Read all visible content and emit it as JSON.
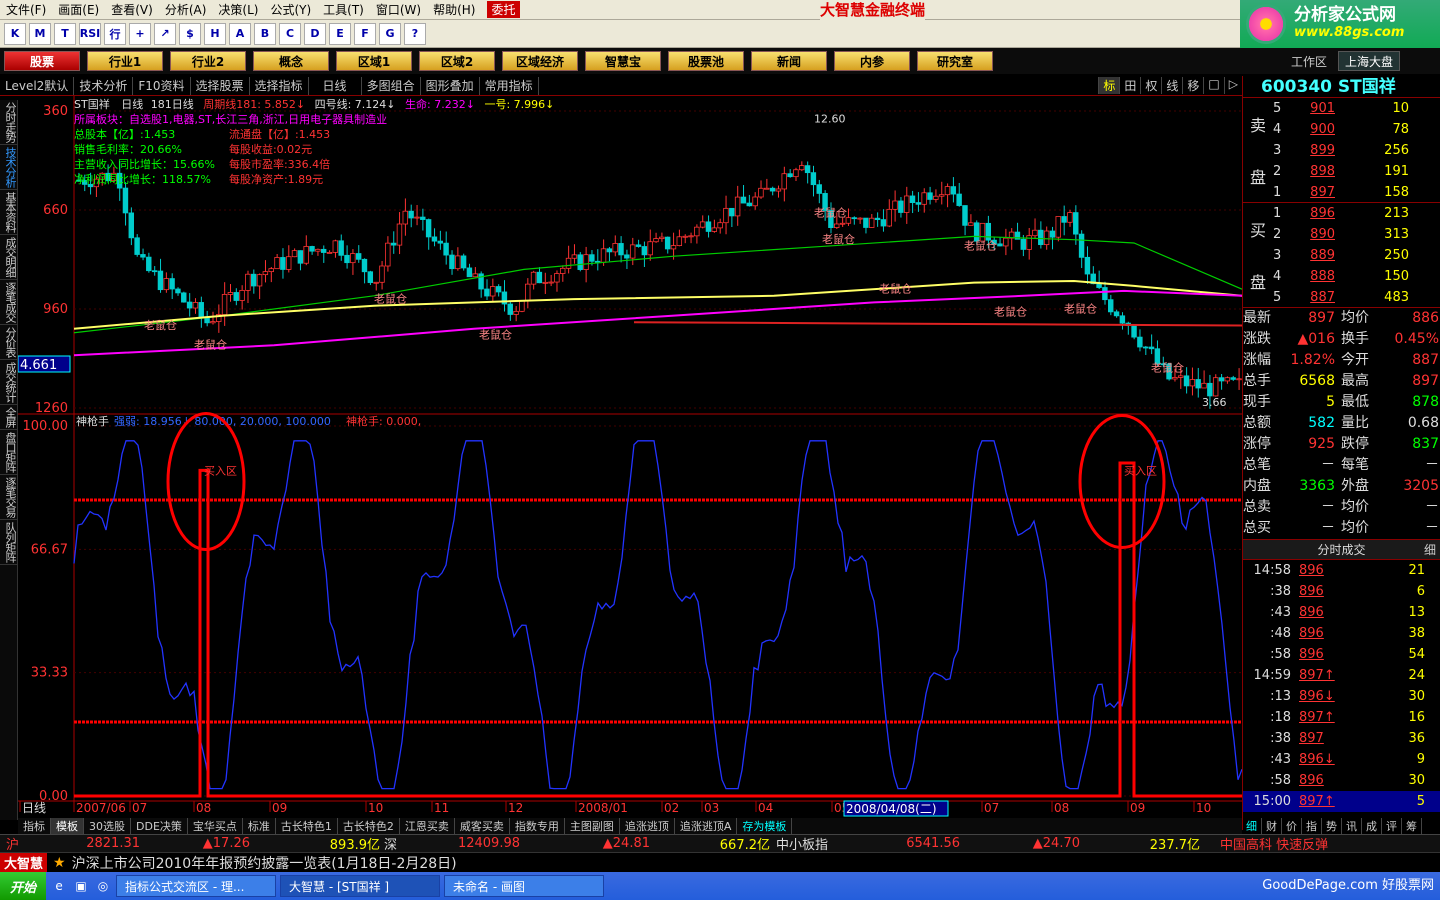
{
  "menu": [
    "文件(F)",
    "画面(E)",
    "查看(V)",
    "分析(A)",
    "决策(L)",
    "公式(Y)",
    "工具(T)",
    "窗口(W)",
    "帮助(H)"
  ],
  "menu_extra": "委托",
  "app_title": "大智慧金融终端",
  "logo": {
    "name": "分析家公式网",
    "url": "www.88gs.com"
  },
  "toolbar_icons": [
    "K",
    "M",
    "T",
    "RSI",
    "行",
    "+",
    "↗",
    "$",
    "H",
    "A",
    "B",
    "C",
    "D",
    "E",
    "F",
    "G",
    "?"
  ],
  "nav": [
    "股票",
    "行业1",
    "行业2",
    "概念",
    "区域1",
    "区域2",
    "区域经济",
    "智慧宝",
    "股票池",
    "新闻",
    "内参",
    "研究室"
  ],
  "nav_right": {
    "workspace": "工作区",
    "market": "上海大盘"
  },
  "subbar": [
    "Level2默认",
    "技术分析",
    "F10资料",
    "选择股票",
    "选择指标",
    "日线",
    "多图组合",
    "图形叠加",
    "常用指标"
  ],
  "subbar_right": [
    "标",
    "田",
    "权",
    "线",
    "移",
    "□",
    "▷"
  ],
  "left_tabs": [
    "分时走势",
    "技术分析",
    "基本资料",
    "成交明细",
    "逐笔成交",
    "分价表",
    "成交统计",
    "全屏",
    "盘口矩阵",
    "逐笔交易",
    "队列矩阵"
  ],
  "chart_header": {
    "name": "ST国祥",
    "period": "日线",
    "ma": "181日线",
    "zhouqi": "周期线181: 5.852↓",
    "sihao": "四号线: 7.124↓",
    "shengming": "生命: 7.232↓",
    "yihao": "一号: 7.996↓",
    "sector": "所属板块：自选股1,电器,ST,长江三角,浙江,日用电子器具制造业",
    "info_left": [
      "总股本【亿】:1.453",
      "销售毛利率：20.66%",
      "主营收入同比增长：15.66%",
      "净利润同比增长：118.57%"
    ],
    "info_right": [
      "流通盘【亿】:1.453",
      "每股收益:0.02元",
      "每股市盈率:336.4倍",
      "每股净资产:1.89元"
    ],
    "price_axis": [
      "1260",
      "960",
      "660",
      "360"
    ],
    "current_price_tag": "4.661",
    "max_label": "12.60",
    "min_label": "3.66",
    "mouse_labels": "老鼠仓"
  },
  "indicator": {
    "name": "神枪手",
    "line1": "强弱: 18.956↓  80.000, 20.000, 100.000",
    "line2": "神枪手: 0.000,",
    "axis": [
      "100.00",
      "66.67",
      "33.33",
      "0.00"
    ],
    "buy_zone": "买入区"
  },
  "chart_data": {
    "type": "line",
    "price_axis": [
      360,
      660,
      960,
      1260
    ],
    "indicator_axis": [
      0,
      33.33,
      66.67,
      100
    ],
    "levels": [
      80,
      20
    ]
  },
  "date_axis": [
    "日线",
    "2007/06",
    "07",
    "08",
    "09",
    "10",
    "11",
    "12",
    "2008/01",
    "02",
    "03",
    "04",
    "05",
    "06",
    "07",
    "08",
    "09",
    "10"
  ],
  "date_highlight": "2008/04/08(二)",
  "bottom_tabs": [
    "指标",
    "模板",
    "30选股",
    "DDE决策",
    "宝华买点",
    "标准",
    "古长特色1",
    "古长特色2",
    "江恩买卖",
    "威客买卖",
    "指数专用",
    "主图副图",
    "追涨逃顶",
    "追涨逃顶A",
    "存为模板"
  ],
  "right_panel": {
    "code": "600340",
    "name": "ST国祥",
    "sell": [
      {
        "n": "5",
        "p": "901",
        "v": "10"
      },
      {
        "n": "4",
        "p": "900",
        "v": "78"
      },
      {
        "n": "3",
        "p": "899",
        "v": "256"
      },
      {
        "n": "2",
        "p": "898",
        "v": "191"
      },
      {
        "n": "1",
        "p": "897",
        "v": "158"
      }
    ],
    "buy": [
      {
        "n": "1",
        "p": "896",
        "v": "213"
      },
      {
        "n": "2",
        "p": "890",
        "v": "313"
      },
      {
        "n": "3",
        "p": "889",
        "v": "250"
      },
      {
        "n": "4",
        "p": "888",
        "v": "150"
      },
      {
        "n": "5",
        "p": "887",
        "v": "483"
      }
    ],
    "sell_label": [
      "卖",
      "盘"
    ],
    "buy_label": [
      "买",
      "盘"
    ],
    "quote": [
      [
        "最新",
        "897",
        "均价",
        "886"
      ],
      [
        "涨跌",
        "▲016",
        "换手",
        "0.45%"
      ],
      [
        "涨幅",
        "1.82%",
        "今开",
        "887"
      ],
      [
        "总手",
        "6568",
        "最高",
        "897"
      ],
      [
        "现手",
        "5",
        "最低",
        "878"
      ],
      [
        "总额",
        "582",
        "量比",
        "0.68"
      ],
      [
        "涨停",
        "925",
        "跌停",
        "837"
      ],
      [
        "总笔",
        "－",
        "每笔",
        "－"
      ],
      [
        "内盘",
        "3363",
        "外盘",
        "3205"
      ],
      [
        "总卖",
        "－",
        "均价",
        "－"
      ],
      [
        "总买",
        "－",
        "均价",
        "－"
      ]
    ],
    "ticks_title": "分时成交",
    "ticks_btn": "细",
    "ticks": [
      {
        "t": "14:58",
        "p": "896",
        "v": "21"
      },
      {
        "t": ":38",
        "p": "896",
        "v": "6"
      },
      {
        "t": ":43",
        "p": "896",
        "v": "13"
      },
      {
        "t": ":48",
        "p": "896",
        "v": "38"
      },
      {
        "t": ":58",
        "p": "896",
        "v": "54"
      },
      {
        "t": "14:59",
        "p": "897↑",
        "v": "24"
      },
      {
        "t": ":13",
        "p": "896↓",
        "v": "30"
      },
      {
        "t": ":18",
        "p": "897↑",
        "v": "16"
      },
      {
        "t": ":38",
        "p": "897",
        "v": "36"
      },
      {
        "t": ":43",
        "p": "896↓",
        "v": "9"
      },
      {
        "t": ":58",
        "p": "896",
        "v": "30"
      },
      {
        "t": "15:00",
        "p": "897↑",
        "v": "5"
      }
    ],
    "tabs": [
      "细",
      "财",
      "价",
      "指",
      "势",
      "讯",
      "成",
      "评",
      "筹"
    ]
  },
  "status": {
    "sh": "沪",
    "sh_idx": "2821.31",
    "sh_chg": "▲17.26",
    "sh_amt": "893.9亿",
    "sz": "深",
    "sz_idx": "12409.98",
    "sz_chg": "▲24.81",
    "sz_amt": "667.2亿",
    "zx": "中小板指",
    "zx_idx": "6541.56",
    "zx_chg": "▲24.70",
    "zx_amt": "237.7亿",
    "right": "中国高科 快速反弹"
  },
  "news": {
    "brand": "大智慧",
    "text": "沪深上市公司2010年年报预约披露一览表(1月18日-2月28日)"
  },
  "taskbar": {
    "start": "开始",
    "tasks": [
      "指标公式交流区 - 理...",
      "大智慧 - [ST国祥 ]",
      "未命名 - 画图"
    ]
  },
  "watermark": "GoodDePage.com 好股票网"
}
